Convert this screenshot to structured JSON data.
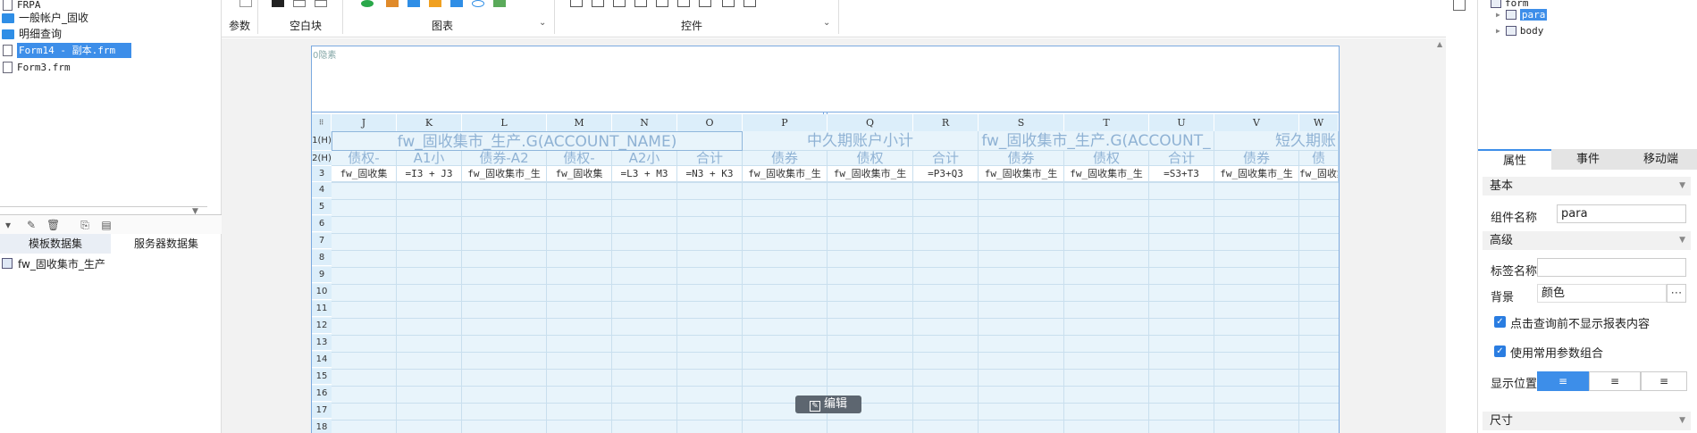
{
  "left_tree": {
    "items": [
      {
        "label": "FRPA",
        "kind": "file"
      },
      {
        "label": "一般帐户_固收",
        "kind": "folder"
      },
      {
        "label": "明细查询",
        "kind": "folder"
      },
      {
        "label": "Form14 - 副本.frm",
        "kind": "file",
        "selected": true
      },
      {
        "label": "Form3.frm",
        "kind": "file"
      }
    ]
  },
  "dataset_tabs": [
    "模板数据集",
    "服务器数据集"
  ],
  "dataset_item": "fw_固收集市_生产",
  "ribbon": {
    "groups": [
      "参数",
      "空白块",
      "图表",
      "控件"
    ]
  },
  "sheet": {
    "title_placeholder": "0隐素",
    "columns": [
      "J",
      "K",
      "L",
      "M",
      "N",
      "O",
      "P",
      "Q",
      "R",
      "S",
      "T",
      "U",
      "V",
      "W"
    ],
    "row_headers": [
      "1(H)",
      "2(H)",
      "3",
      "4",
      "5",
      "6",
      "7",
      "8",
      "9",
      "10",
      "11",
      "12",
      "13",
      "14",
      "15",
      "16",
      "17",
      "18"
    ],
    "row1": [
      "fw_固收集市_生产.G(ACCOUNT_NAME)",
      "中久期账户小计",
      "fw_固收集市_生产.G(ACCOUNT_",
      "短久期账"
    ],
    "row2": [
      "债权-",
      "A1小",
      "债券-A2",
      "债权-",
      "A2小",
      "合计",
      "债券",
      "债权",
      "合计",
      "债券",
      "债权",
      "合计",
      "债券",
      "债"
    ],
    "row3": [
      "fw_固收集",
      "=I3 + J3",
      "fw_固收集市_生",
      "fw_固收集",
      "=L3 + M3",
      "=N3 + K3",
      "fw_固收集市_生",
      "fw_固收集市_生",
      "=P3+Q3",
      "fw_固收集市_生",
      "fw_固收集市_生",
      "=S3+T3",
      "fw_固收集市_生",
      "fw_固收集"
    ]
  },
  "edit_button": "编辑",
  "right_panel": {
    "tree": [
      {
        "label": "form"
      },
      {
        "label": "para",
        "selected": true
      },
      {
        "label": "body"
      }
    ],
    "tabs": [
      "属性",
      "事件",
      "移动端"
    ],
    "sections": {
      "basic": "基本",
      "advanced": "高级",
      "size": "尺寸"
    },
    "fields": {
      "component_name_label": "组件名称",
      "component_name_value": "para",
      "tag_name_label": "标签名称",
      "tag_name_value": "",
      "background_label": "背景",
      "background_value": "颜色",
      "chk1": "点击查询前不显示报表内容",
      "chk2": "使用常用参数组合",
      "position_label": "显示位置"
    },
    "accent": "#3d8ee9"
  }
}
